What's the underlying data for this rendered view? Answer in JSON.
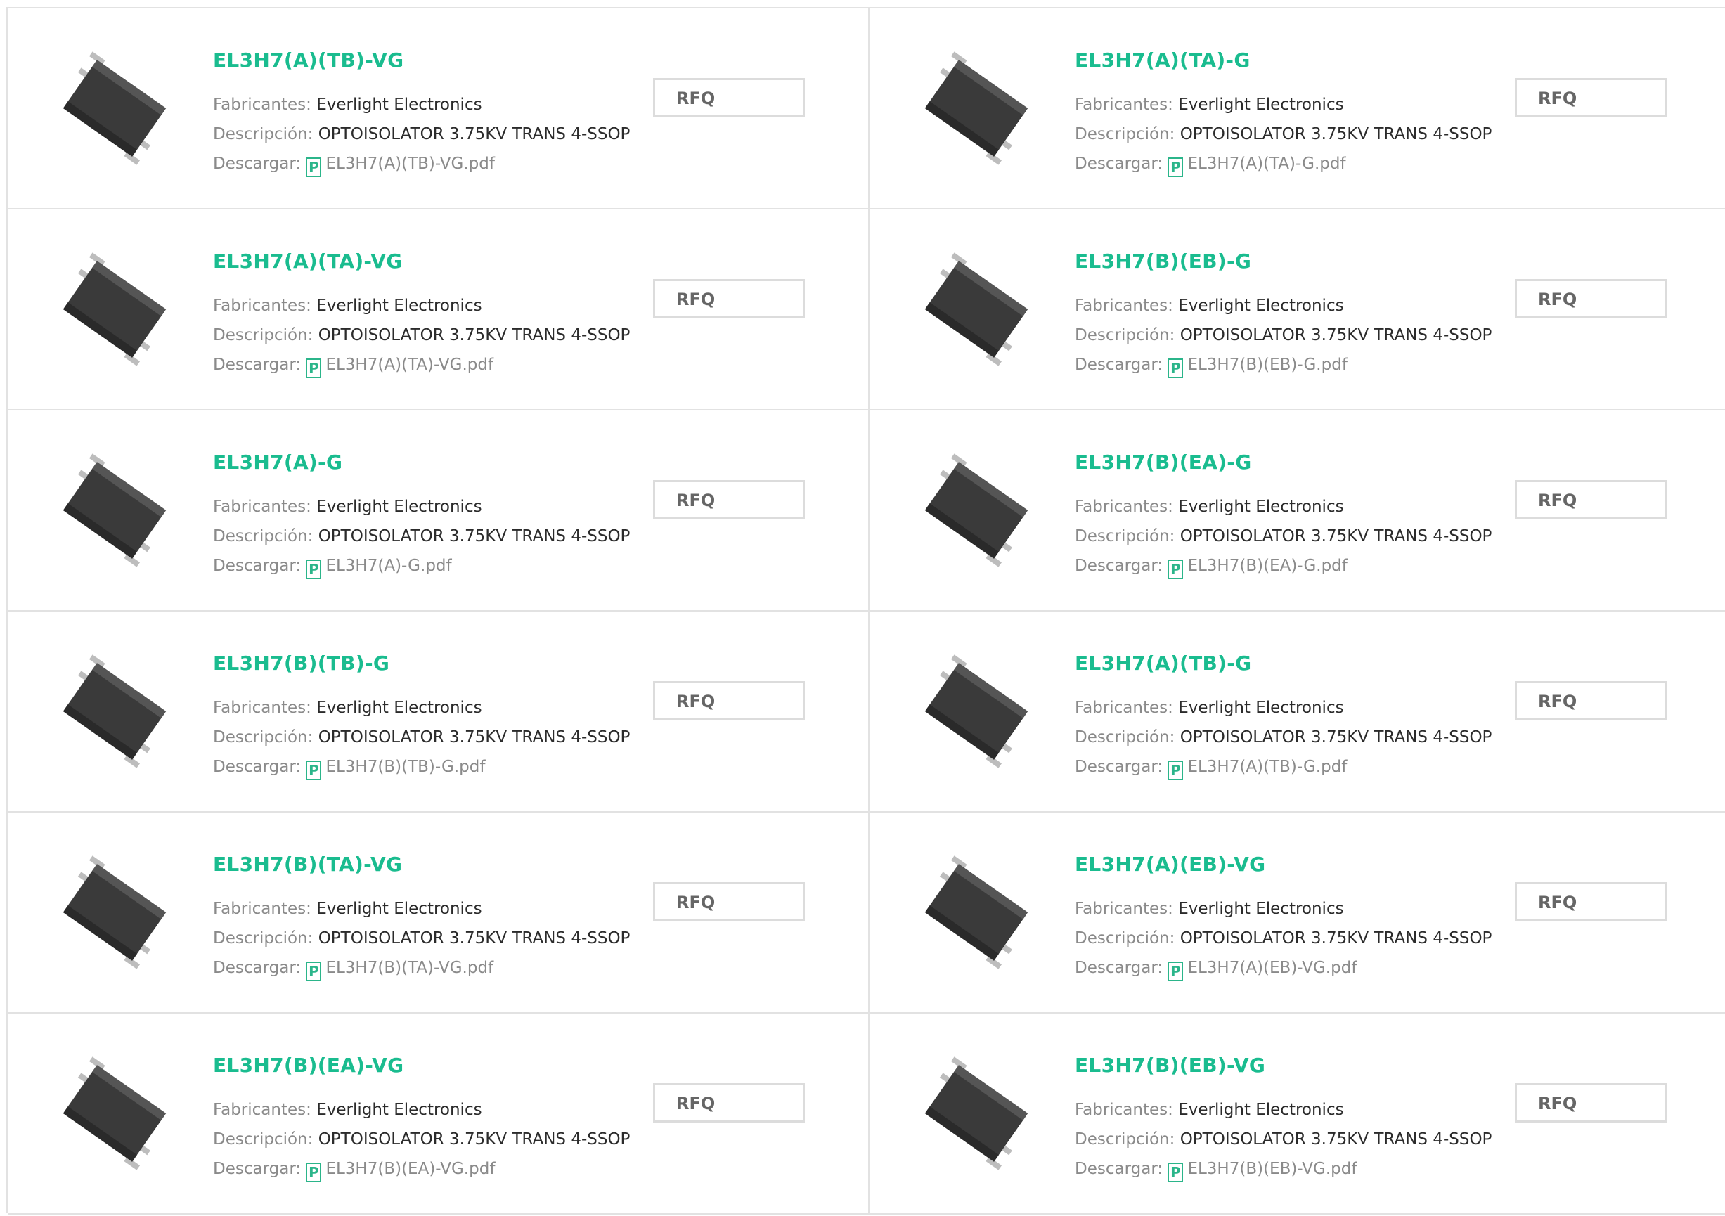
{
  "labels": {
    "manufacturer": "Fabricantes: ",
    "description": "Descripción: ",
    "download": "Descargar: ",
    "pdf_glyph": "P",
    "rfq": "RFQ"
  },
  "products": [
    {
      "part": "EL3H7(A)(TB)-VG",
      "manufacturer": "Everlight Electronics",
      "description": "OPTOISOLATOR 3.75KV TRANS 4-SSOP",
      "file": "EL3H7(A)(TB)-VG.pdf"
    },
    {
      "part": "EL3H7(A)(TA)-G",
      "manufacturer": "Everlight Electronics",
      "description": "OPTOISOLATOR 3.75KV TRANS 4-SSOP",
      "file": "EL3H7(A)(TA)-G.pdf"
    },
    {
      "part": "EL3H7(A)(TA)-VG",
      "manufacturer": "Everlight Electronics",
      "description": "OPTOISOLATOR 3.75KV TRANS 4-SSOP",
      "file": "EL3H7(A)(TA)-VG.pdf"
    },
    {
      "part": "EL3H7(B)(EB)-G",
      "manufacturer": "Everlight Electronics",
      "description": "OPTOISOLATOR 3.75KV TRANS 4-SSOP",
      "file": "EL3H7(B)(EB)-G.pdf"
    },
    {
      "part": "EL3H7(A)-G",
      "manufacturer": "Everlight Electronics",
      "description": "OPTOISOLATOR 3.75KV TRANS 4-SSOP",
      "file": "EL3H7(A)-G.pdf"
    },
    {
      "part": "EL3H7(B)(EA)-G",
      "manufacturer": "Everlight Electronics",
      "description": "OPTOISOLATOR 3.75KV TRANS 4-SSOP",
      "file": "EL3H7(B)(EA)-G.pdf"
    },
    {
      "part": "EL3H7(B)(TB)-G",
      "manufacturer": "Everlight Electronics",
      "description": "OPTOISOLATOR 3.75KV TRANS 4-SSOP",
      "file": "EL3H7(B)(TB)-G.pdf"
    },
    {
      "part": "EL3H7(A)(TB)-G",
      "manufacturer": "Everlight Electronics",
      "description": "OPTOISOLATOR 3.75KV TRANS 4-SSOP",
      "file": "EL3H7(A)(TB)-G.pdf"
    },
    {
      "part": "EL3H7(B)(TA)-VG",
      "manufacturer": "Everlight Electronics",
      "description": "OPTOISOLATOR 3.75KV TRANS 4-SSOP",
      "file": "EL3H7(B)(TA)-VG.pdf"
    },
    {
      "part": "EL3H7(A)(EB)-VG",
      "manufacturer": "Everlight Electronics",
      "description": "OPTOISOLATOR 3.75KV TRANS 4-SSOP",
      "file": "EL3H7(A)(EB)-VG.pdf"
    },
    {
      "part": "EL3H7(B)(EA)-VG",
      "manufacturer": "Everlight Electronics",
      "description": "OPTOISOLATOR 3.75KV TRANS 4-SSOP",
      "file": "EL3H7(B)(EA)-VG.pdf"
    },
    {
      "part": "EL3H7(B)(EB)-VG",
      "manufacturer": "Everlight Electronics",
      "description": "OPTOISOLATOR 3.75KV TRANS 4-SSOP",
      "file": "EL3H7(B)(EB)-VG.pdf"
    }
  ],
  "colors": {
    "part_number": "#1abc8f",
    "label": "#8a8a8a",
    "value": "#2b2b2b",
    "border": "#e2e2e2",
    "pdf_icon": "#2bb58a",
    "chip_body": "#3a3a3a"
  },
  "icons": {
    "product_image": "ssop-4-chip-image",
    "pdf": "pdf-icon"
  }
}
